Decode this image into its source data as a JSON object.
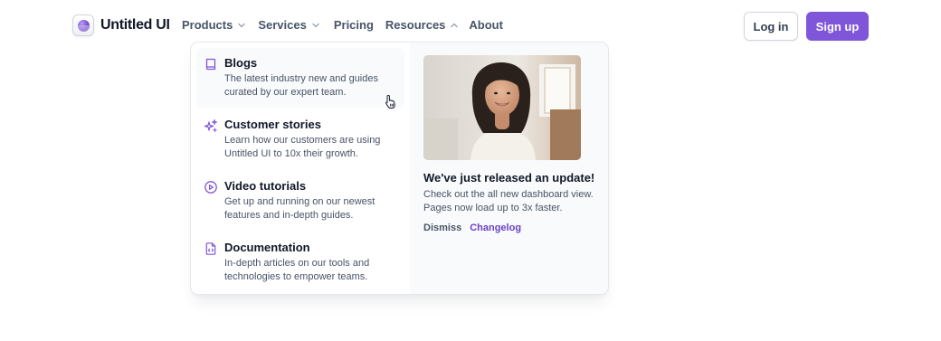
{
  "brand": {
    "name": "Untitled UI",
    "accent": "#7f56d9"
  },
  "nav": {
    "items": [
      {
        "label": "Products",
        "has_dropdown": true,
        "open": false
      },
      {
        "label": "Services",
        "has_dropdown": true,
        "open": false
      },
      {
        "label": "Pricing",
        "has_dropdown": false
      },
      {
        "label": "Resources",
        "has_dropdown": true,
        "open": true
      },
      {
        "label": "About",
        "has_dropdown": false
      }
    ]
  },
  "auth": {
    "login_label": "Log in",
    "signup_label": "Sign up"
  },
  "resources_menu": {
    "items": [
      {
        "icon": "book-icon",
        "title": "Blogs",
        "description": "The latest industry new and guides curated by our expert team."
      },
      {
        "icon": "sparkles-icon",
        "title": "Customer stories",
        "description": "Learn how our customers are using Untitled UI to 10x their growth."
      },
      {
        "icon": "play-circle-icon",
        "title": "Video tutorials",
        "description": "Get up and running on our newest features and in-depth guides."
      },
      {
        "icon": "code-file-icon",
        "title": "Documentation",
        "description": "In-depth articles on our tools and technologies to empower teams."
      }
    ],
    "promo": {
      "image": "smiling-woman-photo",
      "title": "We've just released an update!",
      "description": "Check out the all new dashboard view. Pages now load up to 3x faster.",
      "dismiss_label": "Dismiss",
      "changelog_label": "Changelog"
    }
  }
}
